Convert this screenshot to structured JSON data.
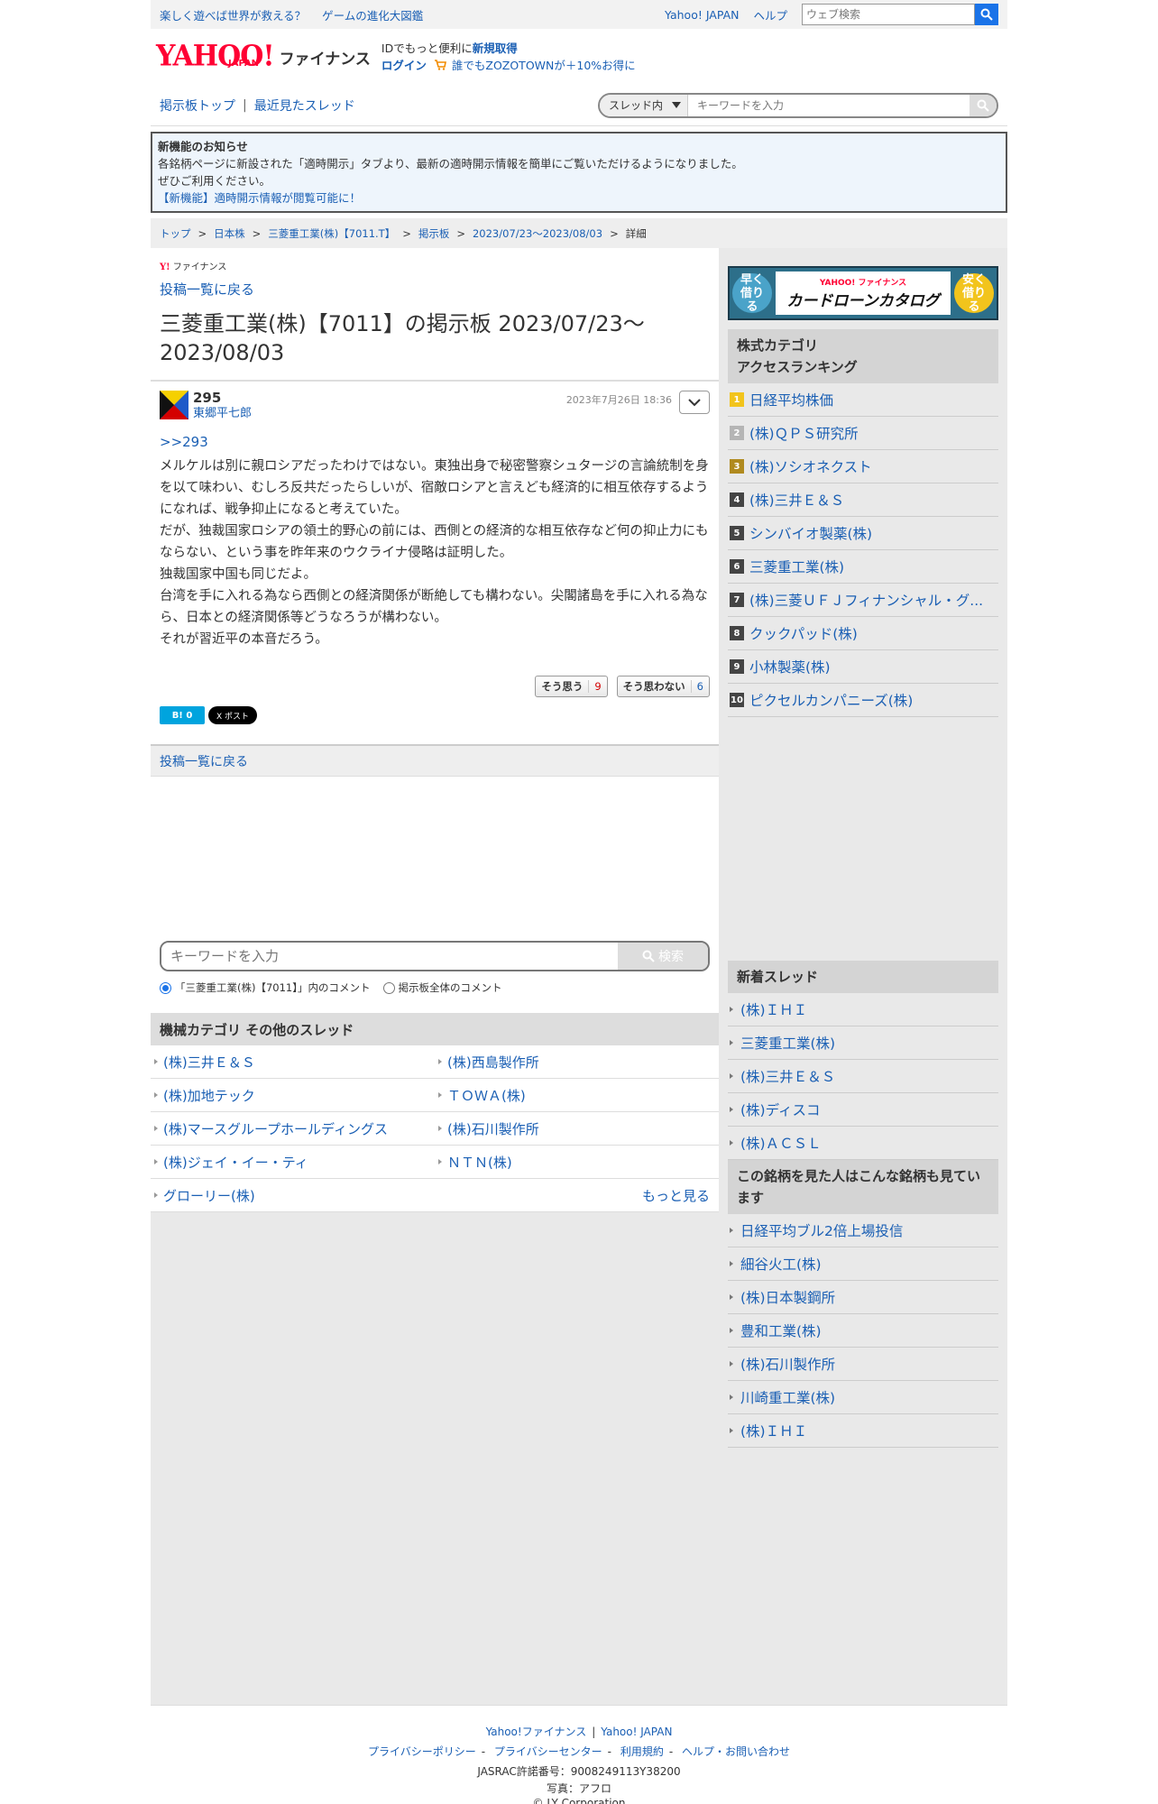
{
  "topbar": {
    "links": [
      "楽しく遊べば世界が救える？",
      "ゲームの進化大図鑑"
    ],
    "right_links": [
      "Yahoo! JAPAN",
      "ヘルプ"
    ],
    "search_placeholder": "ウェブ検索"
  },
  "header": {
    "logo_yahoo": "YAHOO!",
    "logo_japan": "JAPAN",
    "logo_finance": "ファイナンス",
    "id_prefix": "IDでもっと便利に",
    "id_link": "新規取得",
    "login": "ログイン",
    "promo": "誰でもZOZOTOWNが＋10%お得に"
  },
  "boardnav": {
    "top": "掲示板トップ",
    "recent": "最近見たスレッド",
    "scope": "スレッド内",
    "placeholder": "キーワードを入力"
  },
  "notice": {
    "title": "新機能のお知らせ",
    "line1": "各銘柄ページに新設された「適時開示」タブより、最新の適時開示情報を簡単にご覧いただけるようになりました。",
    "line2": "ぜひご利用ください。",
    "link": "【新機能】適時開示情報が閲覧可能に！"
  },
  "breadcrumb": [
    "トップ",
    "日本株",
    "三菱重工業(株)【7011.T】",
    "掲示板",
    "2023/07/23〜2023/08/03",
    "詳細"
  ],
  "main": {
    "mini_logo_y": "Y!",
    "mini_logo_text": "ファイナンス",
    "back_label": "投稿一覧に戻る",
    "title": "三菱重工業(株)【7011】の掲示板 2023/07/23〜2023/08/03"
  },
  "post": {
    "number": "295",
    "user": "東郷平七郎",
    "date": "2023年7月26日 18:36",
    "reply_to": ">>293",
    "body": "メルケルは別に親ロシアだったわけではない。東独出身で秘密警察シュタージの言論統制を身を以て味わい、むしろ反共だったらしいが、宿敵ロシアと言えども経済的に相互依存するようになれば、戦争抑止になると考えていた。\nだが、独裁国家ロシアの領土的野心の前には、西側との経済的な相互依存など何の抑止力にもならない、という事を昨年来のウクライナ侵略は証明した。\n独裁国家中国も同じだよ。\n台湾を手に入れる為なら西側との経済関係が断絶しても構わない。尖閣諸島を手に入れる為なら、日本との経済関係等どうなろうが構わない。\nそれが習近平の本音だろう。",
    "agree_label": "そう思う",
    "agree_count": "9",
    "disagree_label": "そう思わない",
    "disagree_count": "6",
    "hatena": "B! 0",
    "x_post": "X ポスト"
  },
  "back_bar": "投稿一覧に戻る",
  "search": {
    "placeholder": "キーワードを入力",
    "button": "検索",
    "radio1": "「三菱重工業(株)【7011】」内のコメント",
    "radio2": "掲示板全体のコメント"
  },
  "category": {
    "title": "機械カテゴリ その他のスレッド",
    "items": [
      "(株)三井Ｅ＆Ｓ",
      "(株)西島製作所",
      "(株)加地テック",
      "ＴＯＷＡ(株)",
      "(株)マースグループホールディングス",
      "(株)石川製作所",
      "(株)ジェイ・イー・ティ",
      "ＮＴＮ(株)"
    ],
    "last": "グローリー(株)",
    "more": "もっと見る"
  },
  "ad": {
    "left": "早く借りる",
    "brand": "YAHOO! ファイナンス",
    "main": "カードローンカタログ",
    "right": "安く借りる"
  },
  "ranking": {
    "title": "株式カテゴリ アクセスランキング",
    "title_line1": "株式カテゴリ",
    "title_line2": "アクセスランキング",
    "items": [
      {
        "rank": "1",
        "name": "日経平均株価"
      },
      {
        "rank": "2",
        "name": "(株)ＱＰＳ研究所"
      },
      {
        "rank": "3",
        "name": "(株)ソシオネクスト"
      },
      {
        "rank": "4",
        "name": "(株)三井Ｅ＆Ｓ"
      },
      {
        "rank": "5",
        "name": "シンバイオ製薬(株)"
      },
      {
        "rank": "6",
        "name": "三菱重工業(株)"
      },
      {
        "rank": "7",
        "name": "(株)三菱ＵＦＪフィナンシャル・グ..."
      },
      {
        "rank": "8",
        "name": "クックパッド(株)"
      },
      {
        "rank": "9",
        "name": "小林製薬(株)"
      },
      {
        "rank": "10",
        "name": "ピクセルカンパニーズ(株)"
      }
    ],
    "badge_colors": [
      "#f2c41c",
      "#b5b5b5",
      "#b08a1f",
      "#444444"
    ]
  },
  "new_threads": {
    "title": "新着スレッド",
    "items": [
      "(株)ＩＨＩ",
      "三菱重工業(株)",
      "(株)三井Ｅ＆Ｓ",
      "(株)ディスコ",
      "(株)ＡＣＳＬ"
    ]
  },
  "also_viewed": {
    "title": "この銘柄を見た人はこんな銘柄も見ています",
    "items": [
      "日経平均ブル2倍上場投信",
      "細谷火工(株)",
      "(株)日本製鋼所",
      "豊和工業(株)",
      "(株)石川製作所",
      "川崎重工業(株)",
      "(株)ＩＨＩ"
    ]
  },
  "footer": {
    "row1": [
      "Yahoo!ファイナンス",
      "Yahoo! JAPAN"
    ],
    "row2": [
      "プライバシーポリシー",
      "プライバシーセンター",
      "利用規約",
      "ヘルプ・お問い合わせ"
    ],
    "jasrac": "JASRAC許諾番号：9008249113Y38200",
    "photo": "写真：アフロ",
    "copyright": "© LY Corporation"
  }
}
